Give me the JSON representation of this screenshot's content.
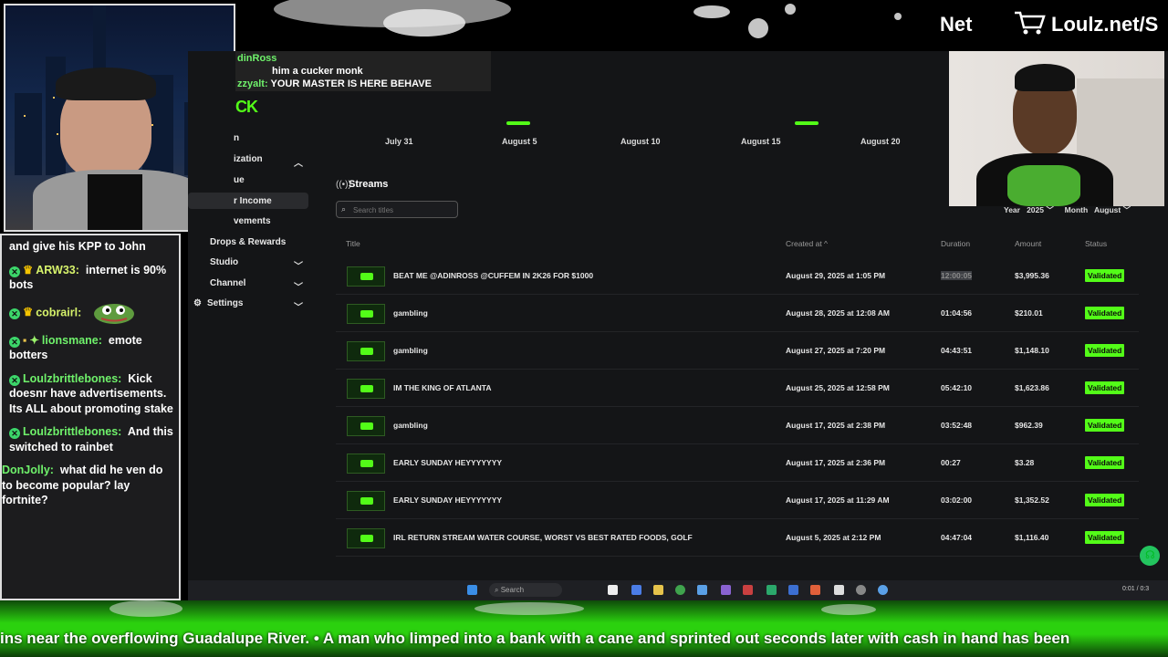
{
  "banner": {
    "net_label": "Net",
    "shop_url": "Loulz.net/S"
  },
  "chat": {
    "partial_top": "and give his KPP to John",
    "messages": [
      {
        "user": "ARW33:",
        "text": "internet is 90% bots"
      },
      {
        "user": "cobrairl:",
        "text": ""
      },
      {
        "user": "lionsmane:",
        "text": "emote botters"
      },
      {
        "user": "Loulzbrittlebones:",
        "text": "Kick doesnr have advertisements. Its ALL about promoting stake"
      },
      {
        "user": "Loulzbrittlebones:",
        "text": "And this switched to rainbet"
      },
      {
        "user": "DonJolly:",
        "text": "what did he ven do to become popular? lay fortnite?"
      }
    ]
  },
  "stream_chat": {
    "line1_user": "dinRoss",
    "line1_text": "him a cucker monk",
    "line2_user": "zzyalt:",
    "line2_text": "YOUR MASTER IS HERE BEHAVE"
  },
  "kick": {
    "logo": "CK",
    "nav": [
      {
        "label": "n",
        "chev": ""
      },
      {
        "label": "ization",
        "chev": "^"
      },
      {
        "label": "ue",
        "chev": ""
      },
      {
        "label": "r Income",
        "chev": ""
      },
      {
        "label": "vements",
        "chev": ""
      },
      {
        "label": "Drops & Rewards",
        "chev": ""
      },
      {
        "label": "Studio",
        "chev": "v"
      },
      {
        "label": "Channel",
        "chev": "v"
      },
      {
        "label": "Settings",
        "chev": "v"
      }
    ],
    "timeline": [
      "July 31",
      "August 5",
      "August 10",
      "August 15",
      "August 20"
    ],
    "streams_title": "Streams",
    "search_placeholder": "Search titles",
    "filters": {
      "year_label": "Year",
      "year_value": "2025",
      "month_label": "Month",
      "month_value": "August"
    },
    "columns": {
      "title": "Title",
      "created": "Created at ^",
      "duration": "Duration",
      "amount": "Amount",
      "status": "Status"
    },
    "rows": [
      {
        "title": "BEAT ME @ADINROSS @CUFFEM IN 2K26 FOR $1000",
        "created": "August 29, 2025 at 1:05 PM",
        "duration": "12:00:05",
        "amount": "$3,995.36",
        "status": "Validated"
      },
      {
        "title": "gambling",
        "created": "August 28, 2025 at 12:08 AM",
        "duration": "01:04:56",
        "amount": "$210.01",
        "status": "Validated"
      },
      {
        "title": "gambling",
        "created": "August 27, 2025 at 7:20 PM",
        "duration": "04:43:51",
        "amount": "$1,148.10",
        "status": "Validated"
      },
      {
        "title": "IM THE KING OF ATLANTA",
        "created": "August 25, 2025 at 12:58 PM",
        "duration": "05:42:10",
        "amount": "$1,623.86",
        "status": "Validated"
      },
      {
        "title": "gambling",
        "created": "August 17, 2025 at 2:38 PM",
        "duration": "03:52:48",
        "amount": "$962.39",
        "status": "Validated"
      },
      {
        "title": "EARLY SUNDAY HEYYYYYYY",
        "created": "August 17, 2025 at 2:36 PM",
        "duration": "00:27",
        "amount": "$3.28",
        "status": "Validated"
      },
      {
        "title": "EARLY SUNDAY HEYYYYYYY",
        "created": "August 17, 2025 at 11:29 AM",
        "duration": "03:02:00",
        "amount": "$1,352.52",
        "status": "Validated"
      },
      {
        "title": "IRL RETURN STREAM WATER COURSE, WORST VS BEST RATED FOODS, GOLF",
        "created": "August 5, 2025 at 2:12 PM",
        "duration": "04:47:04",
        "amount": "$1,116.40",
        "status": "Validated"
      }
    ]
  },
  "taskbar": {
    "search": "Search",
    "time": "0:01 / 0:3"
  },
  "ticker": "ins near the overflowing Guadalupe River.     •     A man who limped into a bank with a cane and sprinted out seconds later with cash in hand has been"
}
